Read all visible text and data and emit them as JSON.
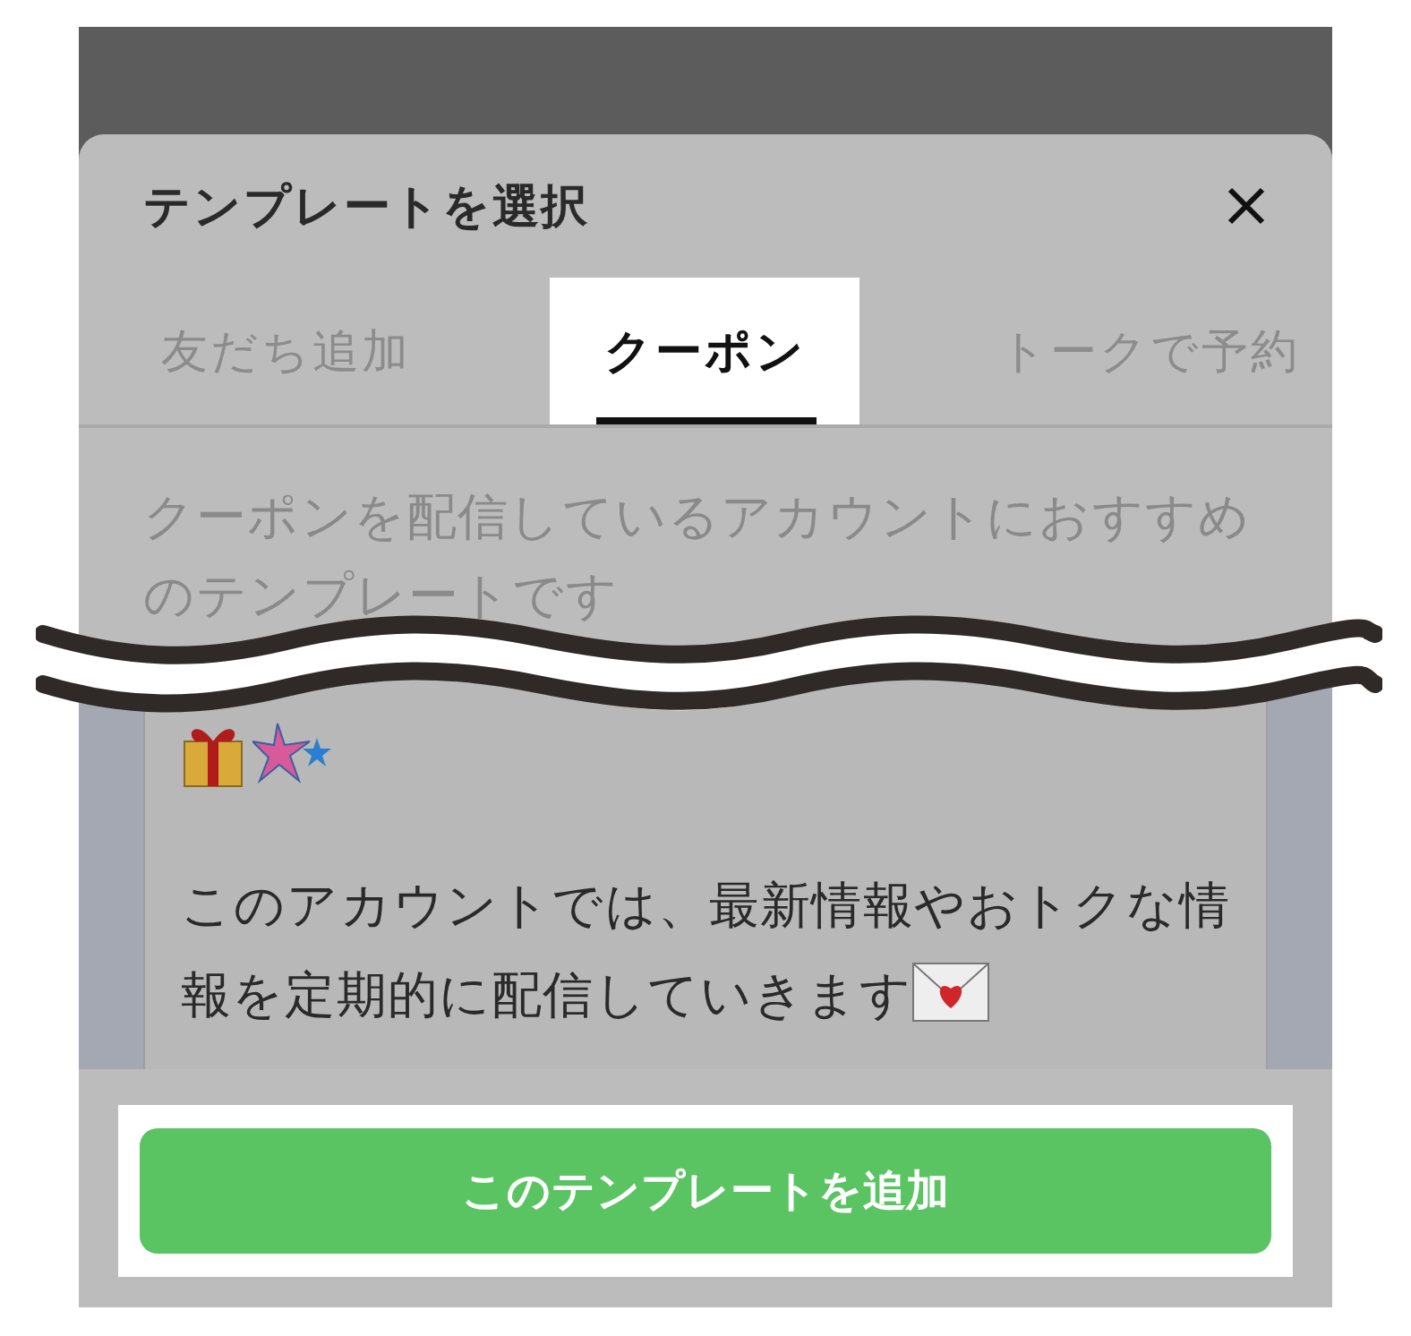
{
  "dialog": {
    "title": "テンプレートを選択"
  },
  "tabs": [
    {
      "label": "友だち追加",
      "selected": false
    },
    {
      "label": "クーポン",
      "selected": true
    },
    {
      "label": "トークで予約",
      "selected": false
    }
  ],
  "description": "クーポンを配信しているアカウントにおすすめのテンプレートです",
  "preview": {
    "message": "このアカウントでは、最新情報やおトクな情報を定期的に配信していきます"
  },
  "button": "このテンプレートを追加"
}
